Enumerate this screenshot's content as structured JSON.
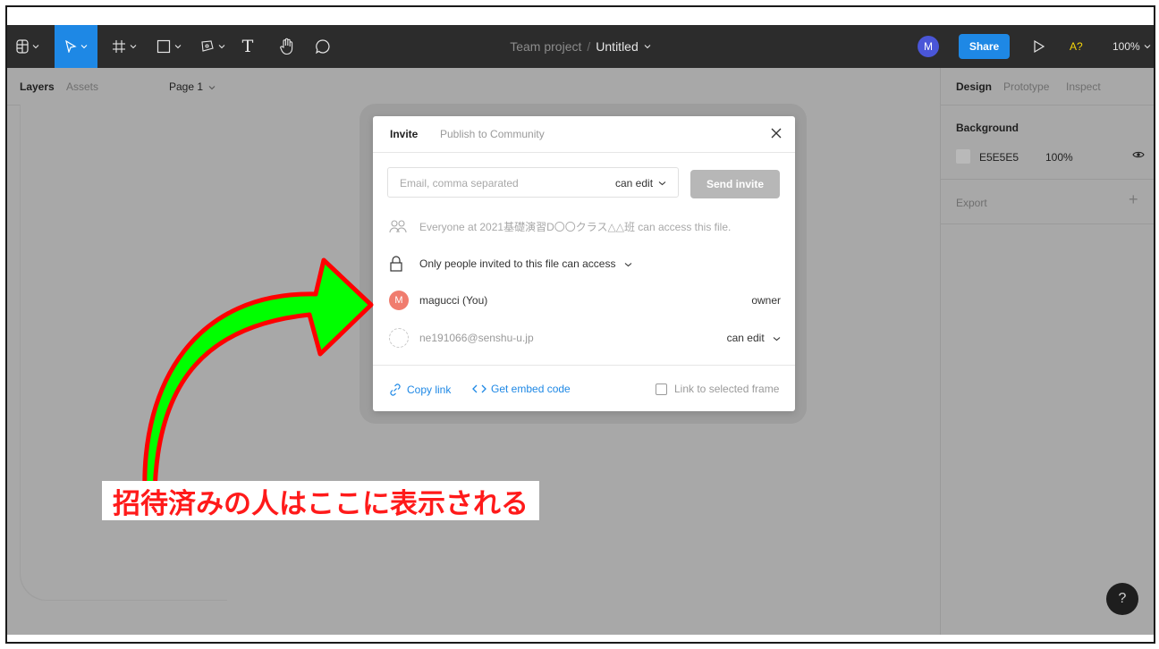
{
  "toolbar": {
    "doc_team": "Team project",
    "doc_sep": "/",
    "doc_name": "Untitled",
    "avatar_initial": "M",
    "share_label": "Share",
    "a_badge": "A?",
    "zoom": "100%",
    "tools": [
      "main-menu-icon",
      "move-tool-icon",
      "frame-tool-icon",
      "shape-tool-icon",
      "pen-tool-icon",
      "text-tool-icon",
      "hand-tool-icon",
      "comment-tool-icon"
    ],
    "tool_text_glyph": "T"
  },
  "left_panel": {
    "layers": "Layers",
    "assets": "Assets",
    "page": "Page 1"
  },
  "right_panel": {
    "design": "Design",
    "prototype": "Prototype",
    "inspect": "Inspect",
    "background_title": "Background",
    "bg_hex": "E5E5E5",
    "bg_opacity": "100%",
    "export": "Export",
    "plus": "+"
  },
  "dialog": {
    "tab_invite": "Invite",
    "tab_publish": "Publish to Community",
    "email_placeholder": "Email, comma separated",
    "perm_select": "can edit",
    "send_invite": "Send invite",
    "everyone_text": "Everyone at 2021基礎演習D〇〇クラス△△班 can access this file.",
    "only_text": "Only people invited to this file can access",
    "users": [
      {
        "initial": "M",
        "name": "magucci (You)",
        "role": "owner"
      },
      {
        "initial": "",
        "name": "ne191066@senshu-u.jp",
        "role": "can edit"
      }
    ],
    "copy_link": "Copy link",
    "embed_code": "Get embed code",
    "link_frame": "Link to selected frame"
  },
  "help": "?",
  "annotation": {
    "caption": "招待済みの人はここに表示される",
    "arrow_fill": "#00ff00",
    "arrow_stroke": "#ff0000",
    "caption_color": "#ff1a1a"
  },
  "colors": {
    "accent": "#1e88e5",
    "toolbar": "#2c2c2c",
    "dim_bg": "#a8a8a8"
  }
}
